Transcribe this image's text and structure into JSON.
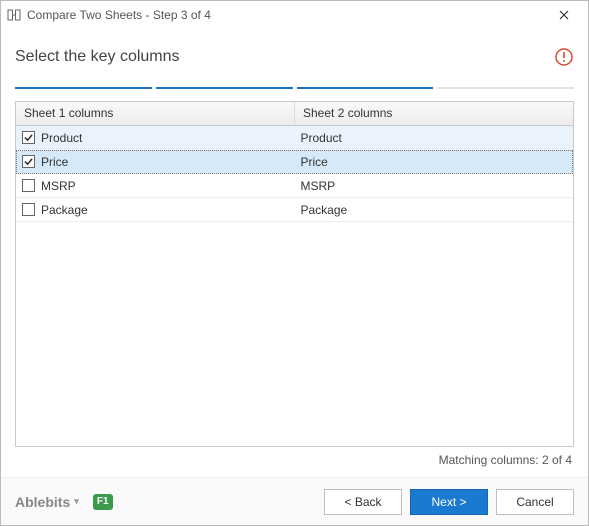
{
  "window": {
    "title": "Compare Two Sheets - Step 3 of 4"
  },
  "header": {
    "heading": "Select the key columns"
  },
  "progress": {
    "current": 3,
    "total": 4
  },
  "table": {
    "headers": {
      "col1": "Sheet 1 columns",
      "col2": "Sheet 2 columns"
    },
    "rows": [
      {
        "checked": true,
        "c1": "Product",
        "c2": "Product"
      },
      {
        "checked": true,
        "c1": "Price",
        "c2": "Price"
      },
      {
        "checked": false,
        "c1": "MSRP",
        "c2": "MSRP"
      },
      {
        "checked": false,
        "c1": "Package",
        "c2": "Package"
      }
    ]
  },
  "status": {
    "matching_text": "Matching columns: 2 of 4"
  },
  "footer": {
    "brand": "Ablebits",
    "help_label": "F1",
    "back": "< Back",
    "next": "Next >",
    "cancel": "Cancel"
  }
}
